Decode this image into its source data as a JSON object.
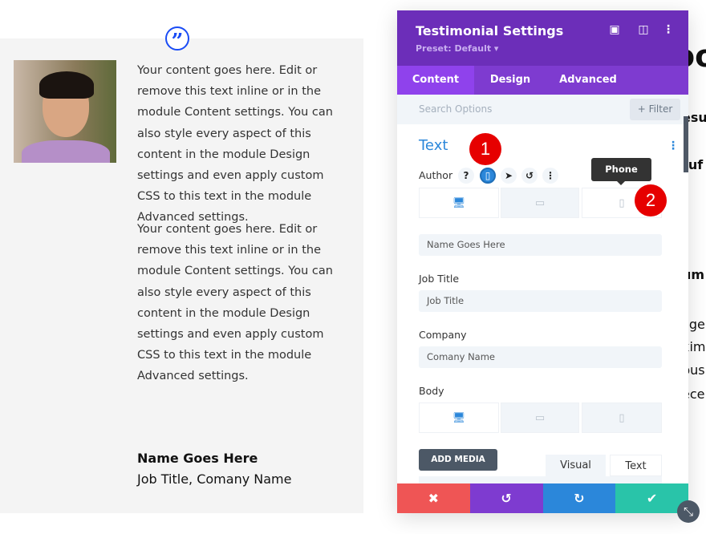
{
  "testimonial": {
    "paragraphs": [
      "Your content goes here. Edit or remove this text inline or in the module Content settings. You can also style every aspect of this content in the module Design settings and even apply custom CSS to this text in the module Advanced settings.",
      "Your content goes here. Edit or remove this text inline or in the module Content settings. You can also style every aspect of this content in the module Design settings and even apply custom CSS to this text in the module Advanced settings."
    ],
    "author": "Name Goes Here",
    "meta": "Job Title, Comany Name",
    "quote_icon": "quote-icon"
  },
  "background_fragments": [
    "oo",
    "esu",
    "ruf",
    "um",
    "lige",
    "xim",
    "bus",
    "ece"
  ],
  "panel": {
    "title": "Testimonial Settings",
    "preset": "Preset: Default ▾",
    "tabs": [
      "Content",
      "Design",
      "Advanced"
    ],
    "active_tab": "Content",
    "search_placeholder": "Search Options",
    "filter_label": "+ Filter",
    "section_title": "Text",
    "author_label": "Author",
    "tooltip": "Phone",
    "author_value": "Name Goes Here",
    "job_title_label": "Job Title",
    "job_title_placeholder": "Job Title",
    "company_label": "Company",
    "company_placeholder": "Comany Name",
    "body_label": "Body",
    "add_media": "ADD MEDIA",
    "editor_tabs": [
      "Visual",
      "Text"
    ],
    "badges": [
      "1",
      "2"
    ]
  },
  "colors": {
    "header": "#6c2eb9",
    "tabs": "#7e3bd0",
    "accent": "#2b87da",
    "cancel": "#ef5555",
    "undo": "#7e3bd0",
    "redo": "#2b87da",
    "save": "#29c4a9",
    "badge": "#e60000"
  }
}
